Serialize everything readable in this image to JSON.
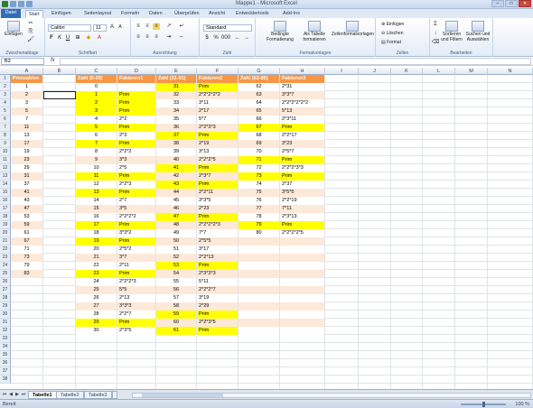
{
  "window": {
    "title": "Mappe1 - Microsoft Excel"
  },
  "ribbon_tabs": [
    "Datei",
    "Start",
    "Einfügen",
    "Seitenlayout",
    "Formeln",
    "Daten",
    "Überprüfen",
    "Ansicht",
    "Entwicklertools",
    "Add-Ins"
  ],
  "active_tab": "Start",
  "ribbon": {
    "paste_label": "Einfügen",
    "font_name": "Calibri",
    "font_size": "11",
    "number_format": "Standard",
    "cond_format_label": "Bedingte Formatierung",
    "as_table_label": "Als Tabelle formatieren",
    "cell_styles_label": "Zellenformatvorlagen",
    "insert_label": "Einfügen",
    "delete_label": "Löschen",
    "format_label": "Format",
    "sort_label": "Sortieren und Filtern",
    "find_label": "Suchen und Auswählen",
    "groups": [
      "Zwischenablage",
      "Schriftart",
      "Ausrichtung",
      "Zahl",
      "Formatvorlagen",
      "Zellen",
      "Bearbeiten"
    ]
  },
  "formula_bar": {
    "name_box": "B3",
    "fx": "fx",
    "content": ""
  },
  "columns": [
    "A",
    "B",
    "C",
    "D",
    "E",
    "F",
    "G",
    "H",
    "I",
    "J",
    "K",
    "L",
    "M",
    "N"
  ],
  "headers": {
    "a": "Primzahlen",
    "c": "Zahl (0-30)",
    "d": "Faktoren1",
    "e": "Zahl (31-61)",
    "f": "Faktoren2",
    "g": "Zahl (62-80)",
    "h": "Faktoren3"
  },
  "primes": [
    "1",
    "2",
    "3",
    "5",
    "7",
    "11",
    "13",
    "17",
    "19",
    "23",
    "29",
    "31",
    "37",
    "41",
    "43",
    "47",
    "53",
    "59",
    "61",
    "67",
    "71",
    "73",
    "79",
    "83"
  ],
  "block1": [
    [
      "0",
      ""
    ],
    [
      "1",
      "Prim"
    ],
    [
      "2",
      "Prim"
    ],
    [
      "3",
      "Prim"
    ],
    [
      "4",
      "2*2"
    ],
    [
      "5",
      "Prim"
    ],
    [
      "6",
      "2*3"
    ],
    [
      "7",
      "Prim"
    ],
    [
      "8",
      "2*2*2"
    ],
    [
      "9",
      "3*3"
    ],
    [
      "10",
      "2*5"
    ],
    [
      "11",
      "Prim"
    ],
    [
      "12",
      "2*2*3"
    ],
    [
      "13",
      "Prim"
    ],
    [
      "14",
      "2*7"
    ],
    [
      "15",
      "3*5"
    ],
    [
      "16",
      "2*2*2*2"
    ],
    [
      "17",
      "Prim"
    ],
    [
      "18",
      "3*3*2"
    ],
    [
      "19",
      "Prim"
    ],
    [
      "20",
      "2*5*2"
    ],
    [
      "21",
      "3*7"
    ],
    [
      "22",
      "2*11"
    ],
    [
      "23",
      "Prim"
    ],
    [
      "24",
      "2*2*2*3"
    ],
    [
      "25",
      "5*5"
    ],
    [
      "26",
      "2*13"
    ],
    [
      "27",
      "3*3*3"
    ],
    [
      "28",
      "2*2*7"
    ],
    [
      "29",
      "Prim"
    ],
    [
      "30",
      "2*3*5"
    ]
  ],
  "block2": [
    [
      "31",
      "Prim"
    ],
    [
      "32",
      "2*2*2*2*2"
    ],
    [
      "33",
      "3*11"
    ],
    [
      "34",
      "2*17"
    ],
    [
      "35",
      "5*7"
    ],
    [
      "36",
      "2*2*3*3"
    ],
    [
      "37",
      "Prim"
    ],
    [
      "38",
      "2*19"
    ],
    [
      "39",
      "3*13"
    ],
    [
      "40",
      "2*2*2*5"
    ],
    [
      "41",
      "Prim"
    ],
    [
      "42",
      "2*3*7"
    ],
    [
      "43",
      "Prim"
    ],
    [
      "44",
      "2*2*11"
    ],
    [
      "45",
      "3*3*5"
    ],
    [
      "46",
      "2*23"
    ],
    [
      "47",
      "Prim"
    ],
    [
      "48",
      "2*2*2*2*3"
    ],
    [
      "49",
      "7*7"
    ],
    [
      "50",
      "2*5*5"
    ],
    [
      "51",
      "3*17"
    ],
    [
      "52",
      "2*2*13"
    ],
    [
      "53",
      "Prim"
    ],
    [
      "54",
      "2*3*3*3"
    ],
    [
      "55",
      "5*11"
    ],
    [
      "56",
      "2*2*2*7"
    ],
    [
      "57",
      "3*19"
    ],
    [
      "58",
      "2*29"
    ],
    [
      "59",
      "Prim"
    ],
    [
      "60",
      "2*2*3*5"
    ],
    [
      "61",
      "Prim"
    ]
  ],
  "block3": [
    [
      "62",
      "2*31"
    ],
    [
      "63",
      "3*3*7"
    ],
    [
      "64",
      "2*2*2*2*2*2"
    ],
    [
      "65",
      "5*13"
    ],
    [
      "66",
      "2*3*11"
    ],
    [
      "67",
      "Prim"
    ],
    [
      "68",
      "2*2*17"
    ],
    [
      "69",
      "3*23"
    ],
    [
      "70",
      "2*5*7"
    ],
    [
      "71",
      "Prim"
    ],
    [
      "72",
      "2*2*2*3*3"
    ],
    [
      "73",
      "Prim"
    ],
    [
      "74",
      "2*37"
    ],
    [
      "75",
      "3*5*5"
    ],
    [
      "76",
      "2*2*19"
    ],
    [
      "77",
      "7*11"
    ],
    [
      "78",
      "2*3*13"
    ],
    [
      "79",
      "Prim"
    ],
    [
      "80",
      "2*2*2*2*5"
    ]
  ],
  "row_numbers": [
    "1",
    "2",
    "3",
    "4",
    "5",
    "6",
    "7",
    "8",
    "9",
    "10",
    "11",
    "12",
    "13",
    "14",
    "15",
    "16",
    "17",
    "18",
    "19",
    "20",
    "21",
    "22",
    "23",
    "24",
    "25",
    "26",
    "27",
    "28",
    "29",
    "30",
    "31",
    "32",
    "33",
    "34",
    "35",
    "36",
    "37",
    "38"
  ],
  "sheets": [
    "Tabelle1",
    "Tabelle2",
    "Tabelle3"
  ],
  "active_sheet": "Tabelle1",
  "status": {
    "ready": "Bereit",
    "zoom": "100 %"
  },
  "colors": {
    "header": "#f79646",
    "peach": "#fde9d9",
    "prime": "#ffff00"
  }
}
